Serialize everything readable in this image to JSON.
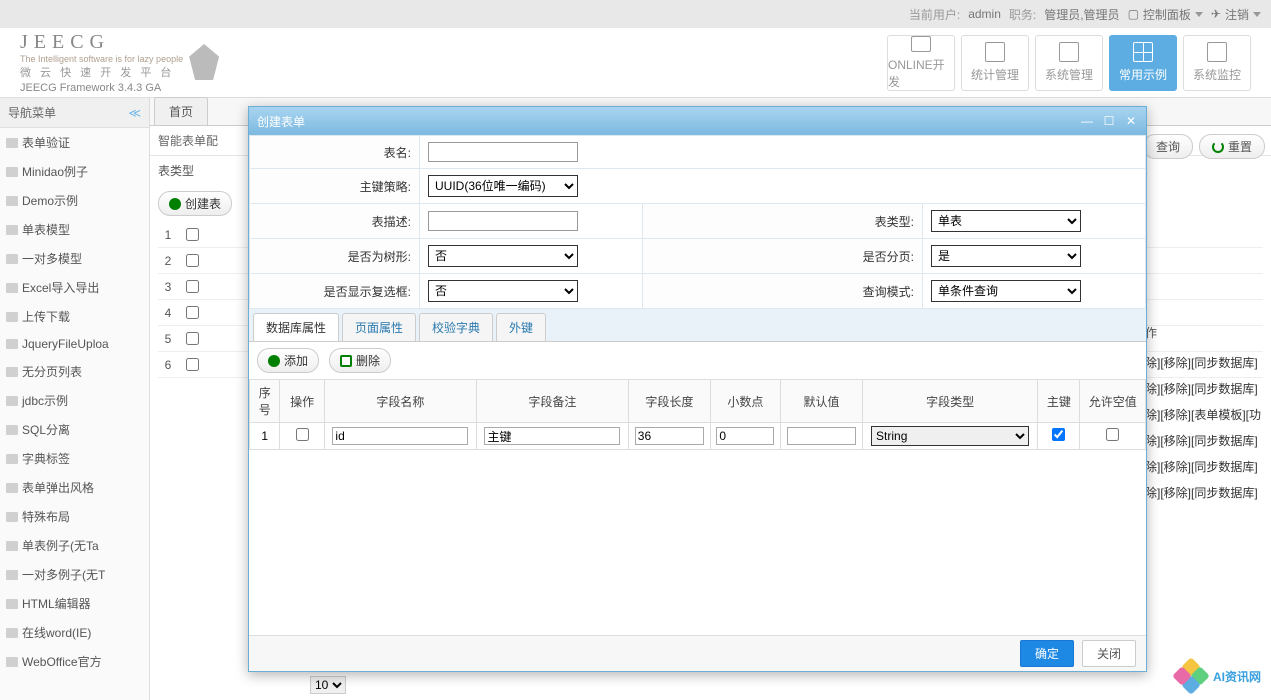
{
  "topbar": {
    "user_label": "当前用户:",
    "user": "admin",
    "role_label": "职务:",
    "role": "管理员,管理员",
    "panel": "控制面板",
    "logout": "注销"
  },
  "logo": {
    "title": "JEECG",
    "sub1": "The Intelligent software is for lazy people",
    "sub2": "微 云 快 速 开 发 平 台",
    "version": "JEECG Framework 3.4.3 GA"
  },
  "nav": [
    {
      "label": "ONLINE开发"
    },
    {
      "label": "统计管理"
    },
    {
      "label": "系统管理"
    },
    {
      "label": "常用示例"
    },
    {
      "label": "系统监控"
    }
  ],
  "sidebar": {
    "title": "导航菜单",
    "items": [
      "表单验证",
      "Minidao例子",
      "Demo示例",
      "单表模型",
      "一对多模型",
      "Excel导入导出",
      "上传下载",
      "JqueryFileUploa",
      "无分页列表",
      "jdbc示例",
      "SQL分离",
      "字典标签",
      "表单弹出风格",
      "特殊布局",
      "单表例子(无Ta",
      "一对多例子(无T",
      "HTML编辑器",
      "在线word(IE)",
      "WebOffice官方"
    ]
  },
  "tabs": {
    "home": "首页"
  },
  "page": {
    "subnav": "智能表单配",
    "subnav2": "表类型",
    "create": "创建表",
    "search_btn": "查询",
    "reset_btn": "重置",
    "op_col": "作",
    "rows": [
      1,
      2,
      3,
      4,
      5,
      6
    ],
    "actions": [
      "除][移除][同步数据库]",
      "除][移除][同步数据库]",
      "除][移除][表单模板][功",
      "除][移除][同步数据库]",
      "除][移除][同步数据库]",
      "除][移除][同步数据库]"
    ],
    "pager_options": [
      "10"
    ]
  },
  "dialog": {
    "title": "创建表单",
    "form": {
      "table_name": {
        "label": "表名:",
        "value": ""
      },
      "pk_strategy": {
        "label": "主键策略:",
        "value": "UUID(36位唯一编码)"
      },
      "table_desc": {
        "label": "表描述:",
        "value": ""
      },
      "table_type": {
        "label": "表类型:",
        "value": "单表"
      },
      "is_tree": {
        "label": "是否为树形:",
        "value": "否"
      },
      "is_page": {
        "label": "是否分页:",
        "value": "是"
      },
      "show_checkbox": {
        "label": "是否显示复选框:",
        "value": "否"
      },
      "query_mode": {
        "label": "查询模式:",
        "value": "单条件查询"
      }
    },
    "subtabs": [
      "数据库属性",
      "页面属性",
      "校验字典",
      "外键"
    ],
    "toolbar": {
      "add": "添加",
      "delete": "删除"
    },
    "grid": {
      "headers": [
        "序号",
        "操作",
        "字段名称",
        "字段备注",
        "字段长度",
        "小数点",
        "默认值",
        "字段类型",
        "主键",
        "允许空值"
      ],
      "row": {
        "num": "1",
        "name": "id",
        "remark": "主键",
        "length": "36",
        "decimal": "0",
        "default": "",
        "type": "String",
        "pk": true,
        "nullable": false
      }
    },
    "footer": {
      "ok": "确定",
      "close": "关闭"
    }
  },
  "watermark": "AI资讯网"
}
